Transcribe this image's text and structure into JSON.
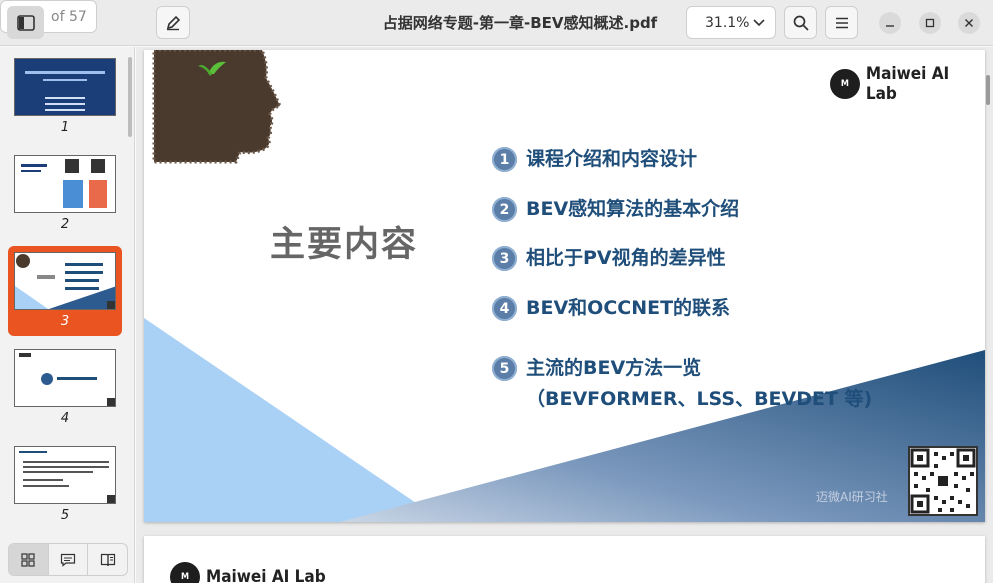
{
  "header": {
    "page_current": "3",
    "page_total": "of 57",
    "title": "占据网络专题-第一章-BEV感知概述.pdf",
    "zoom": "31.1%"
  },
  "sidebar": {
    "thumbnails": [
      {
        "num": "1"
      },
      {
        "num": "2"
      },
      {
        "num": "3"
      },
      {
        "num": "4"
      },
      {
        "num": "5"
      }
    ]
  },
  "slide": {
    "logo_text": "Maiwei AI Lab",
    "heading": "主要内容",
    "items": [
      {
        "num": "1",
        "text": "课程介绍和内容设计"
      },
      {
        "num": "2",
        "text": "BEV感知算法的基本介绍"
      },
      {
        "num": "3",
        "text": "相比于PV视角的差异性"
      },
      {
        "num": "4",
        "text": "BEV和OCCNET的联系"
      },
      {
        "num": "5",
        "text": "主流的BEV方法一览 （BEVFORMER、LSS、BEVDET 等)"
      }
    ],
    "watermark": "迈微AI研习社"
  },
  "page2": {
    "logo_text": "Maiwei AI Lab"
  },
  "colors": {
    "accent": "#e95420",
    "item_text": "#1f4e7a",
    "item_circle": "#5b7ea8",
    "light_triangle": "#a9d0f5",
    "dark_triangle": "#1f4e7a"
  }
}
